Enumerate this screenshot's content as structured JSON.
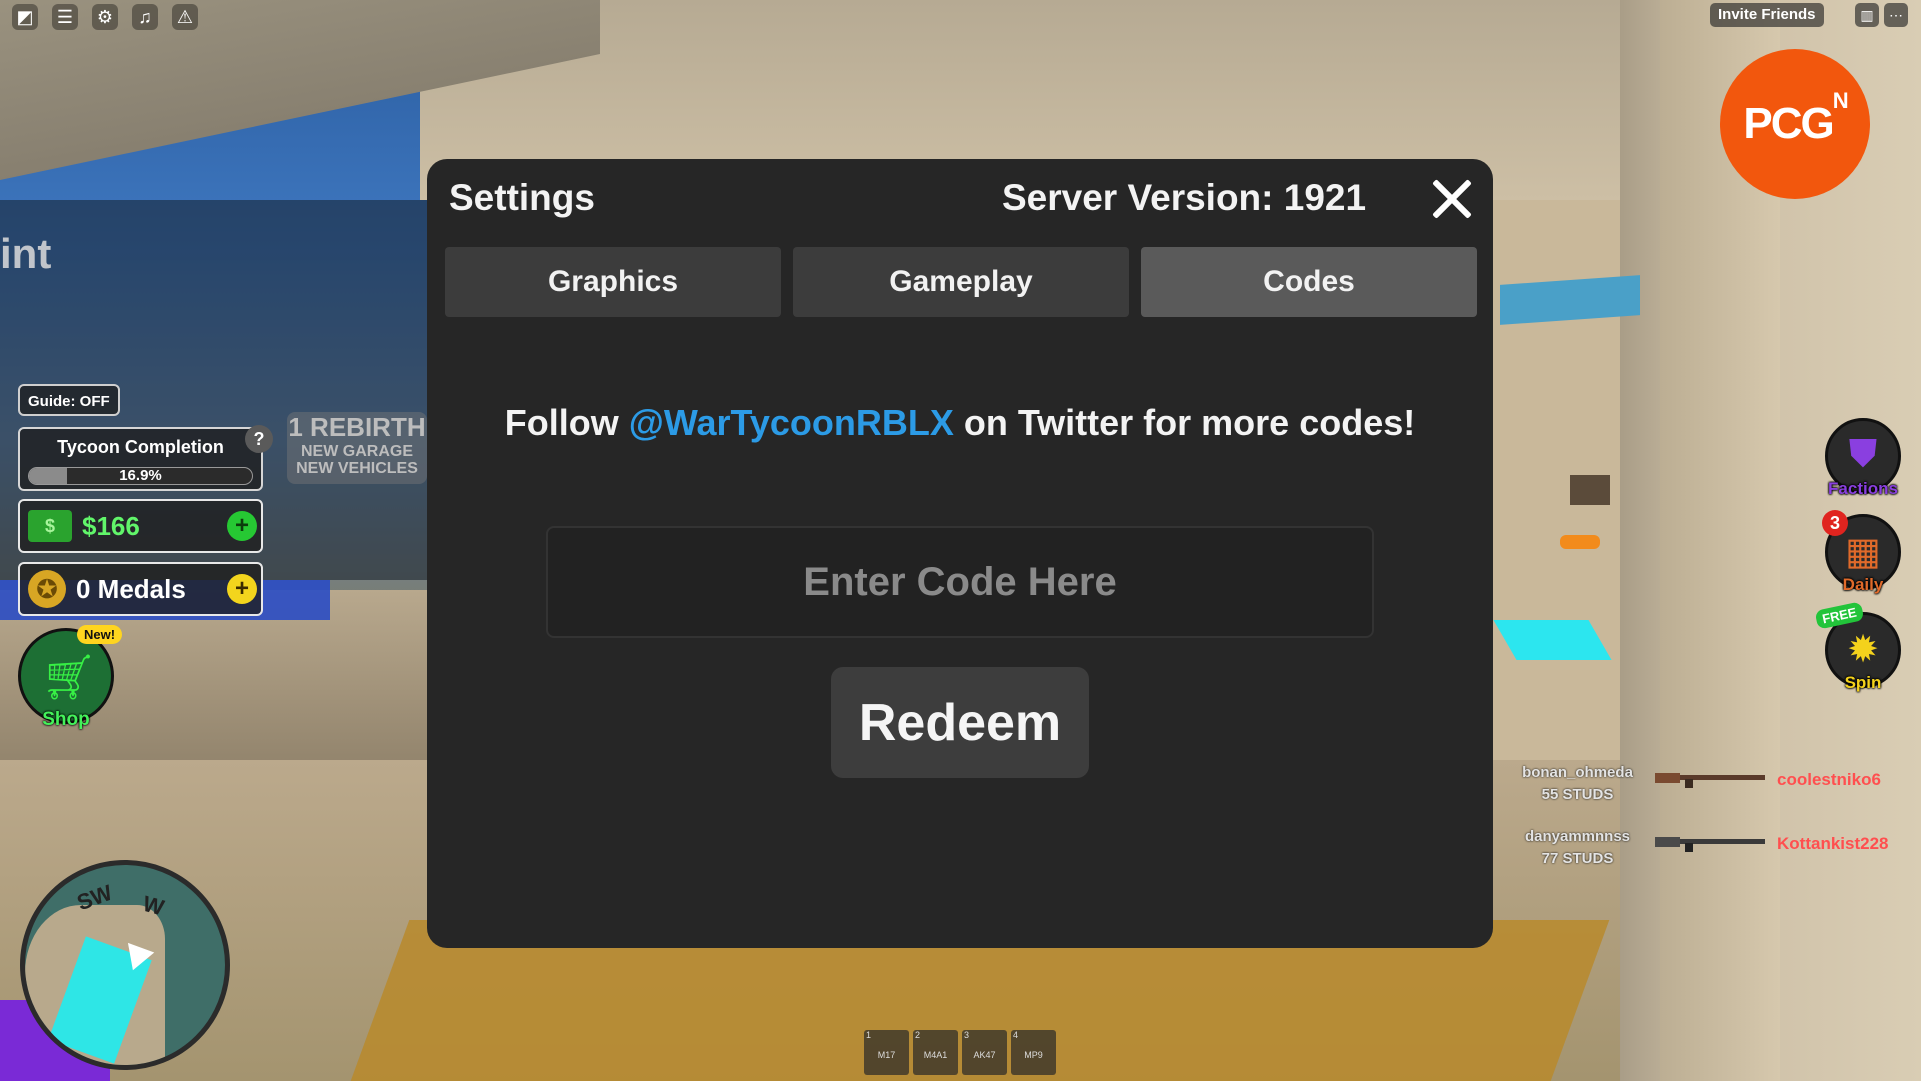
{
  "topbar": {
    "icons": [
      "roblox-menu-icon",
      "chat-icon",
      "settings-gear-icon",
      "music-note-icon",
      "warning-icon"
    ],
    "invite_label": "Invite Friends"
  },
  "watermark": {
    "text": "PCG",
    "sup": "N"
  },
  "world": {
    "sign_text": "int",
    "rebirth_l1": "1 REBIRTH",
    "rebirth_l2": "NEW GARAGE",
    "rebirth_l3": "NEW VEHICLES"
  },
  "hud_left": {
    "guide_label": "Guide: OFF",
    "tycoon_title": "Tycoon Completion",
    "tycoon_percent": "16.9%",
    "tycoon_progress": 0.169,
    "help_label": "?",
    "cash_value": "$166",
    "medals_value": "0 Medals",
    "plus": "+",
    "shop_new": "New!",
    "shop_label": "Shop"
  },
  "minimap": {
    "dir1": "SW",
    "dir2": "W"
  },
  "hud_right": {
    "factions_label": "Factions",
    "daily_label": "Daily",
    "daily_badge": "3",
    "spin_label": "Spin",
    "spin_badge": "FREE"
  },
  "killfeed": [
    {
      "killer": "bonan_ohmeda",
      "distance": "55 STUDS",
      "victim": "coolestniko6"
    },
    {
      "killer": "danyammnnss",
      "distance": "77 STUDS",
      "victim": "Kottankist228"
    }
  ],
  "hotbar": [
    {
      "num": "1",
      "weapon": "M17"
    },
    {
      "num": "2",
      "weapon": "M4A1"
    },
    {
      "num": "3",
      "weapon": "AK47"
    },
    {
      "num": "4",
      "weapon": "MP9"
    }
  ],
  "dialog": {
    "title": "Settings",
    "server_version": "Server Version: 1921",
    "tabs": [
      "Graphics",
      "Gameplay",
      "Codes"
    ],
    "active_tab": "Codes",
    "follow_prefix": "Follow ",
    "follow_handle": "@WarTycoonRBLX",
    "follow_suffix": " on Twitter for more codes!",
    "code_placeholder": "Enter Code Here",
    "code_value": "",
    "redeem_label": "Redeem"
  },
  "colors": {
    "accent_link": "#2c9be6",
    "cash_green": "#61f56a",
    "watermark": "#f2570d",
    "kill_red": "#ff4f4f"
  }
}
